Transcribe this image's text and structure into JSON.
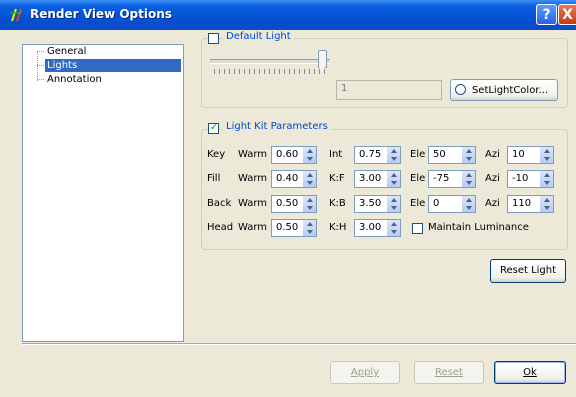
{
  "window": {
    "title": "Render View Options",
    "help_label": "?",
    "close_label": "X"
  },
  "tree": {
    "items": [
      {
        "label": "General",
        "selected": false
      },
      {
        "label": "Lights",
        "selected": true
      },
      {
        "label": "Annotation",
        "selected": false
      }
    ]
  },
  "default_light": {
    "label": "Default Light",
    "checked": false,
    "intensity_value": "1",
    "color_button_label": "SetLightColor..."
  },
  "light_kit": {
    "label": "Light Kit Parameters",
    "checked": true,
    "rows": [
      {
        "name": "Key",
        "warm_label": "Warm",
        "warm": "0.60",
        "p2_label": "Int",
        "p2": "0.75",
        "ele_label": "Ele",
        "ele": "50",
        "azi_label": "Azi",
        "azi": "10"
      },
      {
        "name": "Fill",
        "warm_label": "Warm",
        "warm": "0.40",
        "p2_label": "K:F",
        "p2": "3.00",
        "ele_label": "Ele",
        "ele": "-75",
        "azi_label": "Azi",
        "azi": "-10"
      },
      {
        "name": "Back",
        "warm_label": "Warm",
        "warm": "0.50",
        "p2_label": "K:B",
        "p2": "3.50",
        "ele_label": "Ele",
        "ele": "0",
        "azi_label": "Azi",
        "azi": "110"
      },
      {
        "name": "Head",
        "warm_label": "Warm",
        "warm": "0.50",
        "p2_label": "K:H",
        "p2": "3.00"
      }
    ],
    "maintain_luminance_label": "Maintain Luminance",
    "maintain_luminance_checked": false,
    "reset_light_label": "Reset Light"
  },
  "footer": {
    "apply_label": "Apply",
    "reset_label": "Reset",
    "ok_label": "Ok"
  },
  "colors": {
    "titlebar": "#0550d6",
    "selection": "#316ac5",
    "group_title": "#0046d5",
    "background": "#ece9d8"
  }
}
